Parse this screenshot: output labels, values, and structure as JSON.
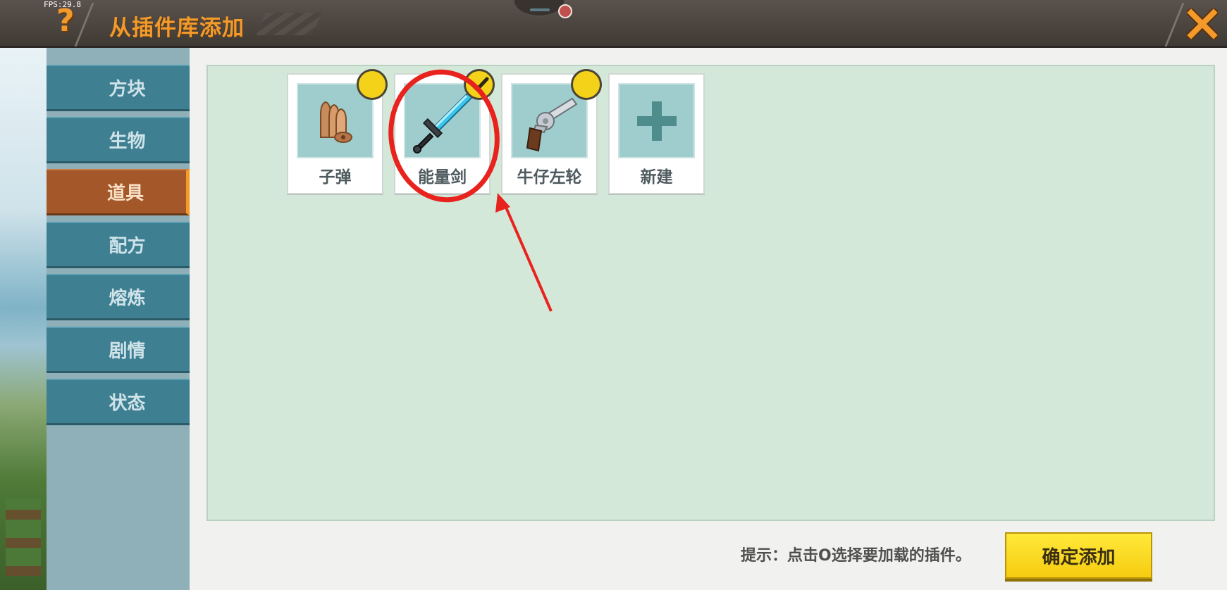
{
  "header": {
    "fps": "FPS:29.8",
    "help_glyph": "?",
    "title": "从插件库添加",
    "close_icon": "close-icon",
    "accent": "#f39a2b"
  },
  "sidebar": {
    "items": [
      {
        "label": "方块",
        "active": false
      },
      {
        "label": "生物",
        "active": false
      },
      {
        "label": "道具",
        "active": true
      },
      {
        "label": "配方",
        "active": false
      },
      {
        "label": "熔炼",
        "active": false
      },
      {
        "label": "剧情",
        "active": false
      },
      {
        "label": "状态",
        "active": false
      }
    ]
  },
  "plugins": [
    {
      "label": "子弹",
      "icon": "bullets-icon",
      "checked": false
    },
    {
      "label": "能量剑",
      "icon": "energy-sword-icon",
      "checked": true
    },
    {
      "label": "牛仔左轮",
      "icon": "revolver-icon",
      "checked": false
    },
    {
      "label": "新建",
      "icon": "plus-icon",
      "checked": false
    }
  ],
  "footer": {
    "hint": "提示：点击O选择要加载的插件。",
    "confirm_label": "确定添加",
    "confirm_color": "#f6cc10"
  },
  "annotation": {
    "highlight_color": "#e8231e"
  }
}
